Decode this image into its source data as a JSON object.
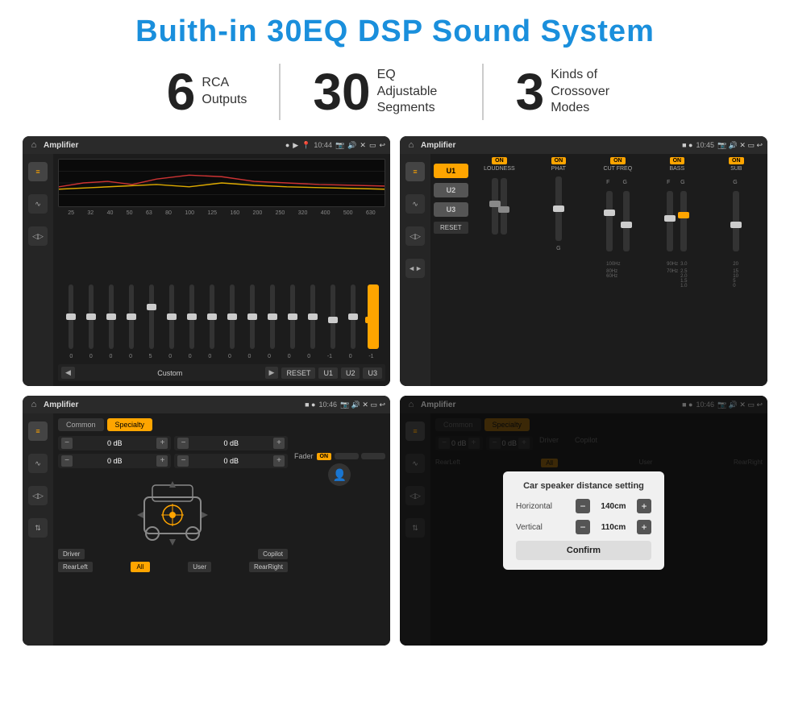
{
  "page": {
    "title": "Buith-in 30EQ DSP Sound System",
    "stats": [
      {
        "number": "6",
        "text": "RCA\nOutputs"
      },
      {
        "number": "30",
        "text": "EQ Adjustable\nSegments"
      },
      {
        "number": "3",
        "text": "Kinds of\nCrossover Modes"
      }
    ]
  },
  "screens": [
    {
      "id": "eq-screen",
      "topbar": {
        "title": "Amplifier",
        "time": "10:44"
      },
      "type": "equalizer"
    },
    {
      "id": "amp-screen",
      "topbar": {
        "title": "Amplifier",
        "time": "10:45"
      },
      "type": "amplifier"
    },
    {
      "id": "fader-screen",
      "topbar": {
        "title": "Amplifier",
        "time": "10:46"
      },
      "type": "fader"
    },
    {
      "id": "dialog-screen",
      "topbar": {
        "title": "Amplifier",
        "time": "10:46"
      },
      "type": "dialog"
    }
  ],
  "eq": {
    "frequencies": [
      "25",
      "32",
      "40",
      "50",
      "63",
      "80",
      "100",
      "125",
      "160",
      "200",
      "250",
      "320",
      "400",
      "500",
      "630"
    ],
    "values": [
      "0",
      "0",
      "0",
      "0",
      "5",
      "0",
      "0",
      "0",
      "0",
      "0",
      "0",
      "0",
      "0",
      "-1",
      "0",
      "-1"
    ],
    "preset": "Custom",
    "buttons": [
      "RESET",
      "U1",
      "U2",
      "U3"
    ]
  },
  "amp": {
    "channels": [
      "U1",
      "U2",
      "U3"
    ],
    "controls": [
      "LOUDNESS",
      "PHAT",
      "CUT FREQ",
      "BASS",
      "SUB"
    ],
    "reset": "RESET"
  },
  "fader": {
    "tabs": [
      "Common",
      "Specialty"
    ],
    "activeTab": "Specialty",
    "faderLabel": "Fader",
    "onLabel": "ON",
    "dbValues": [
      "0 dB",
      "0 dB",
      "0 dB",
      "0 dB"
    ],
    "locations": [
      "Driver",
      "Copilot",
      "RearLeft",
      "All",
      "User",
      "RearRight"
    ]
  },
  "dialog": {
    "title": "Car speaker distance setting",
    "horizontal": {
      "label": "Horizontal",
      "value": "140cm"
    },
    "vertical": {
      "label": "Vertical",
      "value": "110cm"
    },
    "confirm": "Confirm"
  }
}
